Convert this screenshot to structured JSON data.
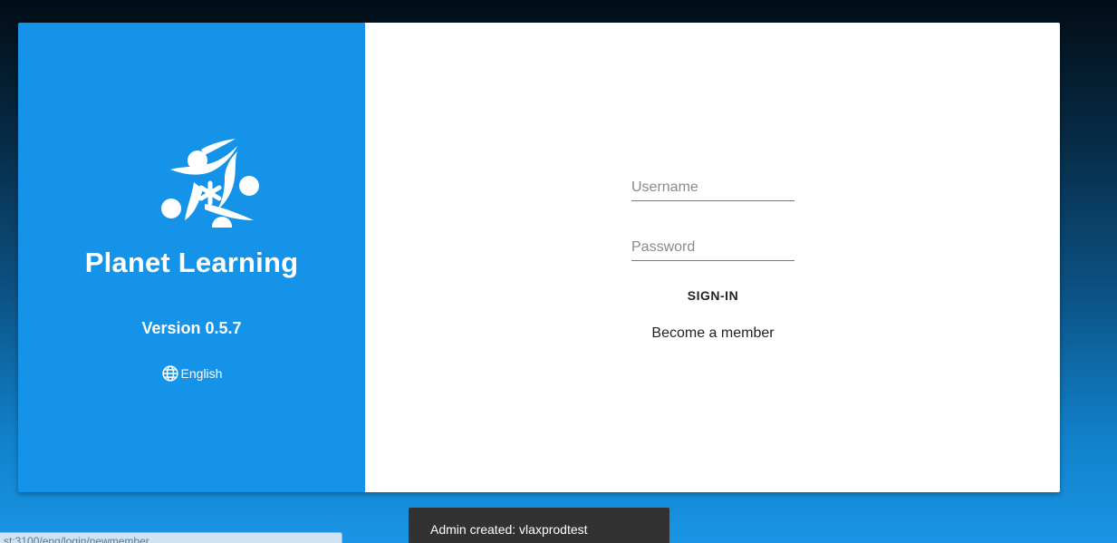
{
  "brand": {
    "app_name": "Planet Learning",
    "version_label": "Version 0.5.7",
    "language_label": "English",
    "logo_icon": "planet-learning-logo",
    "language_icon": "globe-icon",
    "panel_color": "#1493e9"
  },
  "login_form": {
    "username_placeholder": "Username",
    "username_value": "",
    "password_placeholder": "Password",
    "password_value": "",
    "signin_label": "SIGN-IN",
    "become_member_label": "Become a member"
  },
  "status_bar": {
    "url_text": "st:3100/eng/login/newmember"
  },
  "snackbar": {
    "message": "Admin created: vlaxprodtest"
  }
}
